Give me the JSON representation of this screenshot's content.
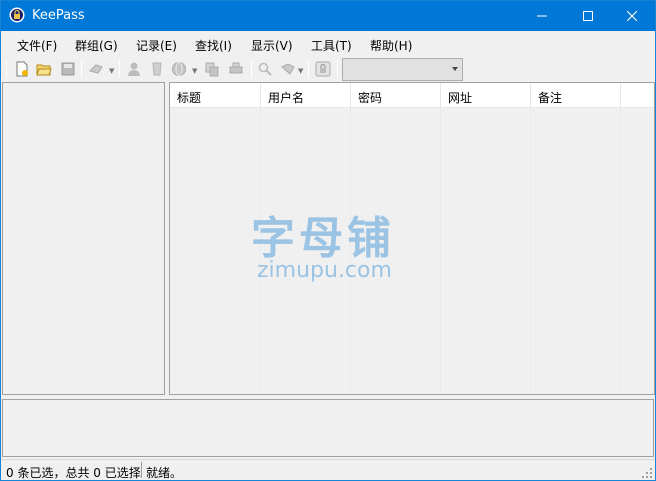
{
  "window": {
    "title": "KeePass"
  },
  "menu": [
    "文件(F)",
    "群组(G)",
    "记录(E)",
    "查找(I)",
    "显示(V)",
    "工具(T)",
    "帮助(H)"
  ],
  "toolbar": {
    "icons": [
      "new-database-icon",
      "open-database-icon",
      "save-icon",
      "add-entry-icon",
      "copy-username-icon",
      "copy-password-icon",
      "open-url-icon",
      "copy-entry-icon",
      "perform-autotype-icon",
      "find-icon",
      "lock-icon"
    ],
    "quick_find_value": ""
  },
  "entries_table": {
    "columns": [
      "标题",
      "用户名",
      "密码",
      "网址",
      "备注"
    ],
    "rows": []
  },
  "watermark": {
    "cn": "字母铺",
    "en": "zimupu.com"
  },
  "status": {
    "selection": "0 条已选，总共 0 已选择",
    "state": "就绪。"
  },
  "colors": {
    "titlebar": "#0078d7",
    "window_bg": "#f0f0f0",
    "list_header_bg": "#ffffff",
    "watermark": "#7fb4df"
  }
}
